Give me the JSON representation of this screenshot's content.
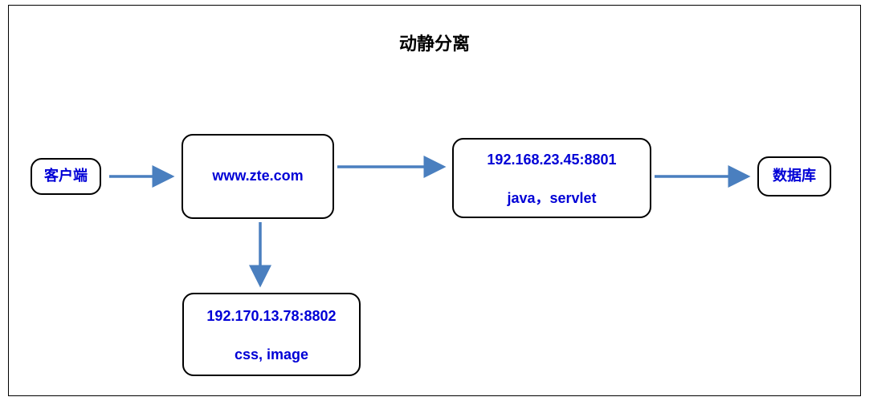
{
  "title": "动静分离",
  "nodes": {
    "client": {
      "label": "客户端"
    },
    "gateway": {
      "label": "www.zte.com"
    },
    "dynamic": {
      "line1": "192.168.23.45:8801",
      "line2": "java，servlet"
    },
    "static": {
      "line1": "192.170.13.78:8802",
      "line2": "css, image"
    },
    "db": {
      "label": "数据库"
    }
  },
  "colors": {
    "arrow": "#4A7FBF",
    "text": "#0000d6",
    "border": "#000000"
  }
}
